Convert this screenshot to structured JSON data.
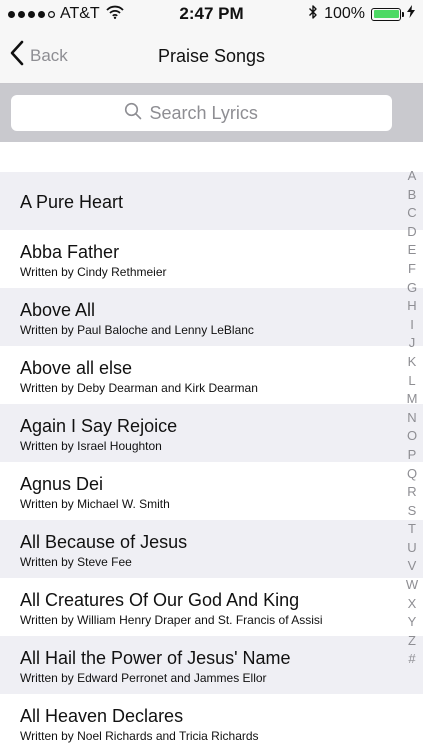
{
  "status_bar": {
    "carrier": "AT&T",
    "time": "2:47 PM",
    "battery_percent": "100%",
    "battery_level": 1.0,
    "battery_color": "#4cd964"
  },
  "nav": {
    "back_label": "Back",
    "title": "Praise Songs"
  },
  "search": {
    "placeholder": "Search Lyrics",
    "value": ""
  },
  "songs": [
    {
      "title": "A Pure Heart",
      "author": ""
    },
    {
      "title": "Abba Father",
      "author": "Written by Cindy Rethmeier"
    },
    {
      "title": "Above All",
      "author": "Written by Paul Baloche and Lenny LeBlanc"
    },
    {
      "title": "Above all else",
      "author": "Written by Deby Dearman and Kirk Dearman"
    },
    {
      "title": "Again I Say Rejoice",
      "author": "Written by Israel Houghton"
    },
    {
      "title": "Agnus Dei",
      "author": "Written by Michael W. Smith"
    },
    {
      "title": "All Because of Jesus",
      "author": "Written by Steve Fee"
    },
    {
      "title": "All Creatures Of Our God And King",
      "author": "Written by William Henry Draper and St. Francis of Assisi"
    },
    {
      "title": "All Hail the Power of Jesus' Name",
      "author": "Written by Edward Perronet and Jammes Ellor"
    },
    {
      "title": "All Heaven Declares",
      "author": "Written by Noel Richards and Tricia Richards"
    }
  ],
  "index_letters": [
    "A",
    "B",
    "C",
    "D",
    "E",
    "F",
    "G",
    "H",
    "I",
    "J",
    "K",
    "L",
    "M",
    "N",
    "O",
    "P",
    "Q",
    "R",
    "S",
    "T",
    "U",
    "V",
    "W",
    "X",
    "Y",
    "Z",
    "#"
  ],
  "icons": {
    "back": "chevron-left-icon",
    "search": "search-icon",
    "wifi": "wifi-icon",
    "bluetooth": "bluetooth-icon",
    "battery": "battery-icon",
    "signal": "signal-icon"
  }
}
